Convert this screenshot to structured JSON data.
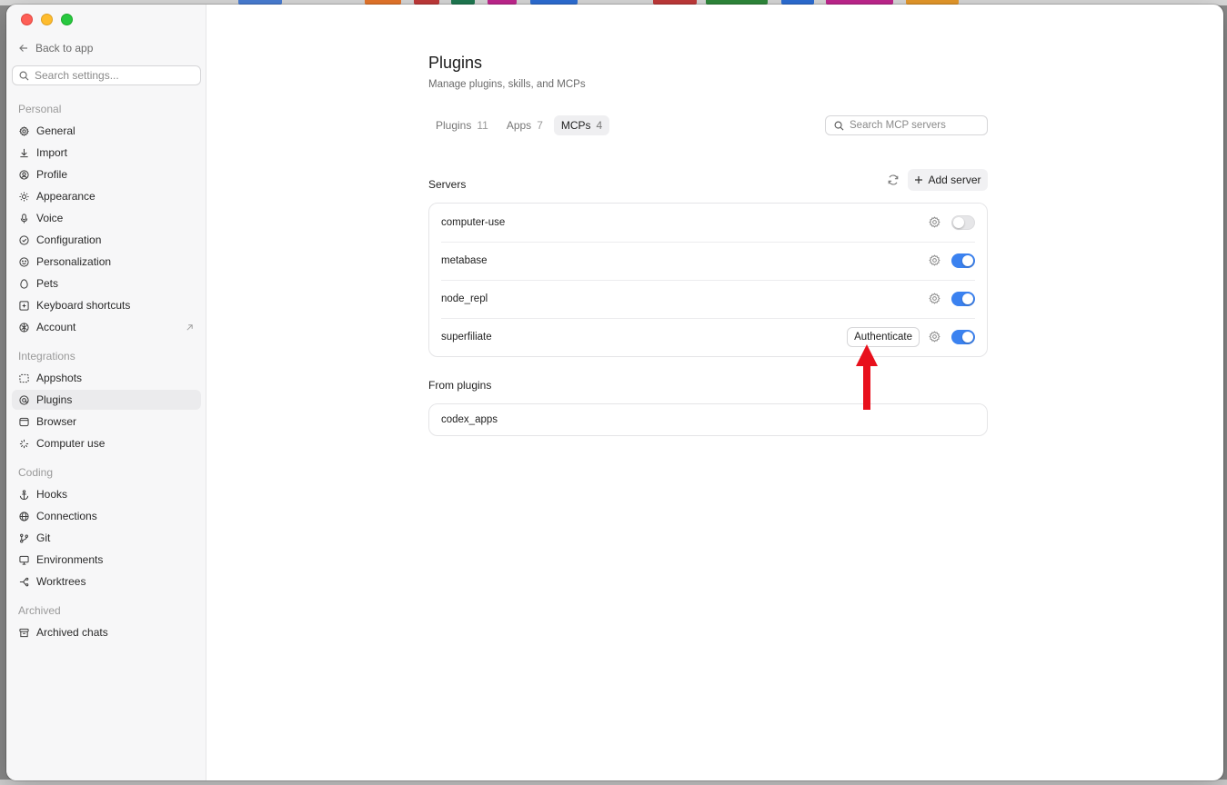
{
  "colors": {
    "accent": "#3b82f0",
    "annotation_arrow": "#e8101c",
    "sidebar_bg": "#f7f7f8"
  },
  "sidebar": {
    "back_label": "Back to app",
    "search_placeholder": "Search settings...",
    "sections": [
      {
        "label": "Personal",
        "items": [
          {
            "label": "General",
            "icon": "gear-icon"
          },
          {
            "label": "Import",
            "icon": "download-icon"
          },
          {
            "label": "Profile",
            "icon": "profile-icon"
          },
          {
            "label": "Appearance",
            "icon": "sun-icon"
          },
          {
            "label": "Voice",
            "icon": "microphone-icon"
          },
          {
            "label": "Configuration",
            "icon": "config-icon"
          },
          {
            "label": "Personalization",
            "icon": "smiley-icon"
          },
          {
            "label": "Pets",
            "icon": "egg-icon"
          },
          {
            "label": "Keyboard shortcuts",
            "icon": "keyboard-icon"
          },
          {
            "label": "Account",
            "icon": "account-icon",
            "external": true
          }
        ]
      },
      {
        "label": "Integrations",
        "items": [
          {
            "label": "Appshots",
            "icon": "screenshot-icon"
          },
          {
            "label": "Plugins",
            "icon": "plugin-icon",
            "active": true
          },
          {
            "label": "Browser",
            "icon": "browser-icon"
          },
          {
            "label": "Computer use",
            "icon": "sparkle-icon"
          }
        ]
      },
      {
        "label": "Coding",
        "items": [
          {
            "label": "Hooks",
            "icon": "anchor-icon"
          },
          {
            "label": "Connections",
            "icon": "globe-icon"
          },
          {
            "label": "Git",
            "icon": "git-branch-icon"
          },
          {
            "label": "Environments",
            "icon": "monitor-icon"
          },
          {
            "label": "Worktrees",
            "icon": "worktree-icon"
          }
        ]
      },
      {
        "label": "Archived",
        "items": [
          {
            "label": "Archived chats",
            "icon": "archive-icon"
          }
        ]
      }
    ]
  },
  "main": {
    "title": "Plugins",
    "subtitle": "Manage plugins, skills, and MCPs",
    "tabs": [
      {
        "label": "Plugins",
        "count": "11"
      },
      {
        "label": "Apps",
        "count": "7"
      },
      {
        "label": "MCPs",
        "count": "4",
        "active": true
      }
    ],
    "search_placeholder": "Search MCP servers",
    "servers_heading": "Servers",
    "add_server_label": "Add server",
    "servers": [
      {
        "name": "computer-use",
        "enabled": false
      },
      {
        "name": "metabase",
        "enabled": true
      },
      {
        "name": "node_repl",
        "enabled": true
      },
      {
        "name": "superfiliate",
        "enabled": true,
        "action": "Authenticate"
      }
    ],
    "from_plugins_heading": "From plugins",
    "plugin_servers": [
      {
        "name": "codex_apps"
      }
    ]
  }
}
